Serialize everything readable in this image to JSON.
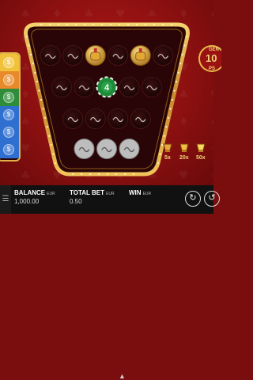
{
  "logo_text": [
    "GEN",
    "10",
    "PS"
  ],
  "left_strip": {
    "colors": [
      "#f0c23a",
      "#e98a2a",
      "#2e8c3a",
      "#2f6fd0",
      "#2f6fd0",
      "#2f6fd0"
    ],
    "symbols": [
      "$",
      "$",
      "$",
      "$",
      "$",
      "$"
    ]
  },
  "board": {
    "rows": [
      [
        "empty",
        "empty",
        "gold",
        "empty",
        "gold",
        "empty"
      ],
      [
        "empty",
        "empty",
        "green",
        "empty",
        "empty"
      ],
      [
        "empty",
        "empty",
        "empty",
        "empty"
      ],
      [
        "empty",
        "empty",
        "empty"
      ]
    ],
    "green_chip_value": "4"
  },
  "multipliers": [
    "5x",
    "20x",
    "50x"
  ],
  "hud": {
    "balance_label": "BALANCE",
    "balance_currency": "EUR",
    "balance_value": "1,000.00",
    "total_bet_label": "TOTAL BET",
    "total_bet_currency": "EUR",
    "total_bet_value": "0.50",
    "win_label": "WIN",
    "win_currency": "EUR",
    "win_value": ""
  },
  "icons": {
    "menu": "menu-icon",
    "arrow": "chevron-up-icon",
    "autoplay": "autoplay-icon",
    "spin": "spin-icon"
  },
  "colors": {
    "background": "#8c1010",
    "frame_gold": "#e0b24a",
    "hud_bg": "#111111"
  }
}
